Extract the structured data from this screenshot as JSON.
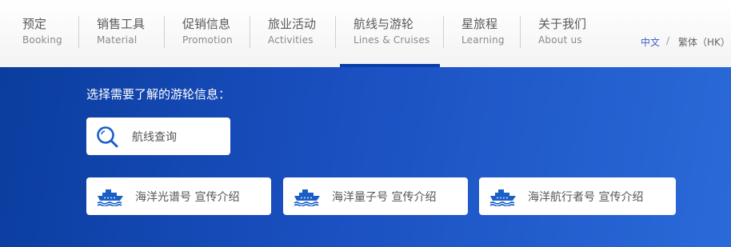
{
  "nav": {
    "items": [
      {
        "cn": "预定",
        "en": "Booking"
      },
      {
        "cn": "销售工具",
        "en": "Material"
      },
      {
        "cn": "促销信息",
        "en": "Promotion"
      },
      {
        "cn": "旅业活动",
        "en": "Activities"
      },
      {
        "cn": "航线与游轮",
        "en": "Lines & Cruises"
      },
      {
        "cn": "星旅程",
        "en": "Learning"
      },
      {
        "cn": "关于我们",
        "en": "About us"
      }
    ],
    "active_index": 4,
    "active_color": "#0a3ea8"
  },
  "lang": {
    "zh": "中文",
    "separator": "/",
    "hk": "繁体（HK）"
  },
  "hero": {
    "prompt": "选择需要了解的游轮信息：",
    "search_label": "航线查询",
    "ships": [
      {
        "label": "海洋光谱号 宣传介绍"
      },
      {
        "label": "海洋量子号 宣传介绍"
      },
      {
        "label": "海洋航行者号 宣传介绍"
      }
    ],
    "icon_color": "#1a5fc7"
  }
}
